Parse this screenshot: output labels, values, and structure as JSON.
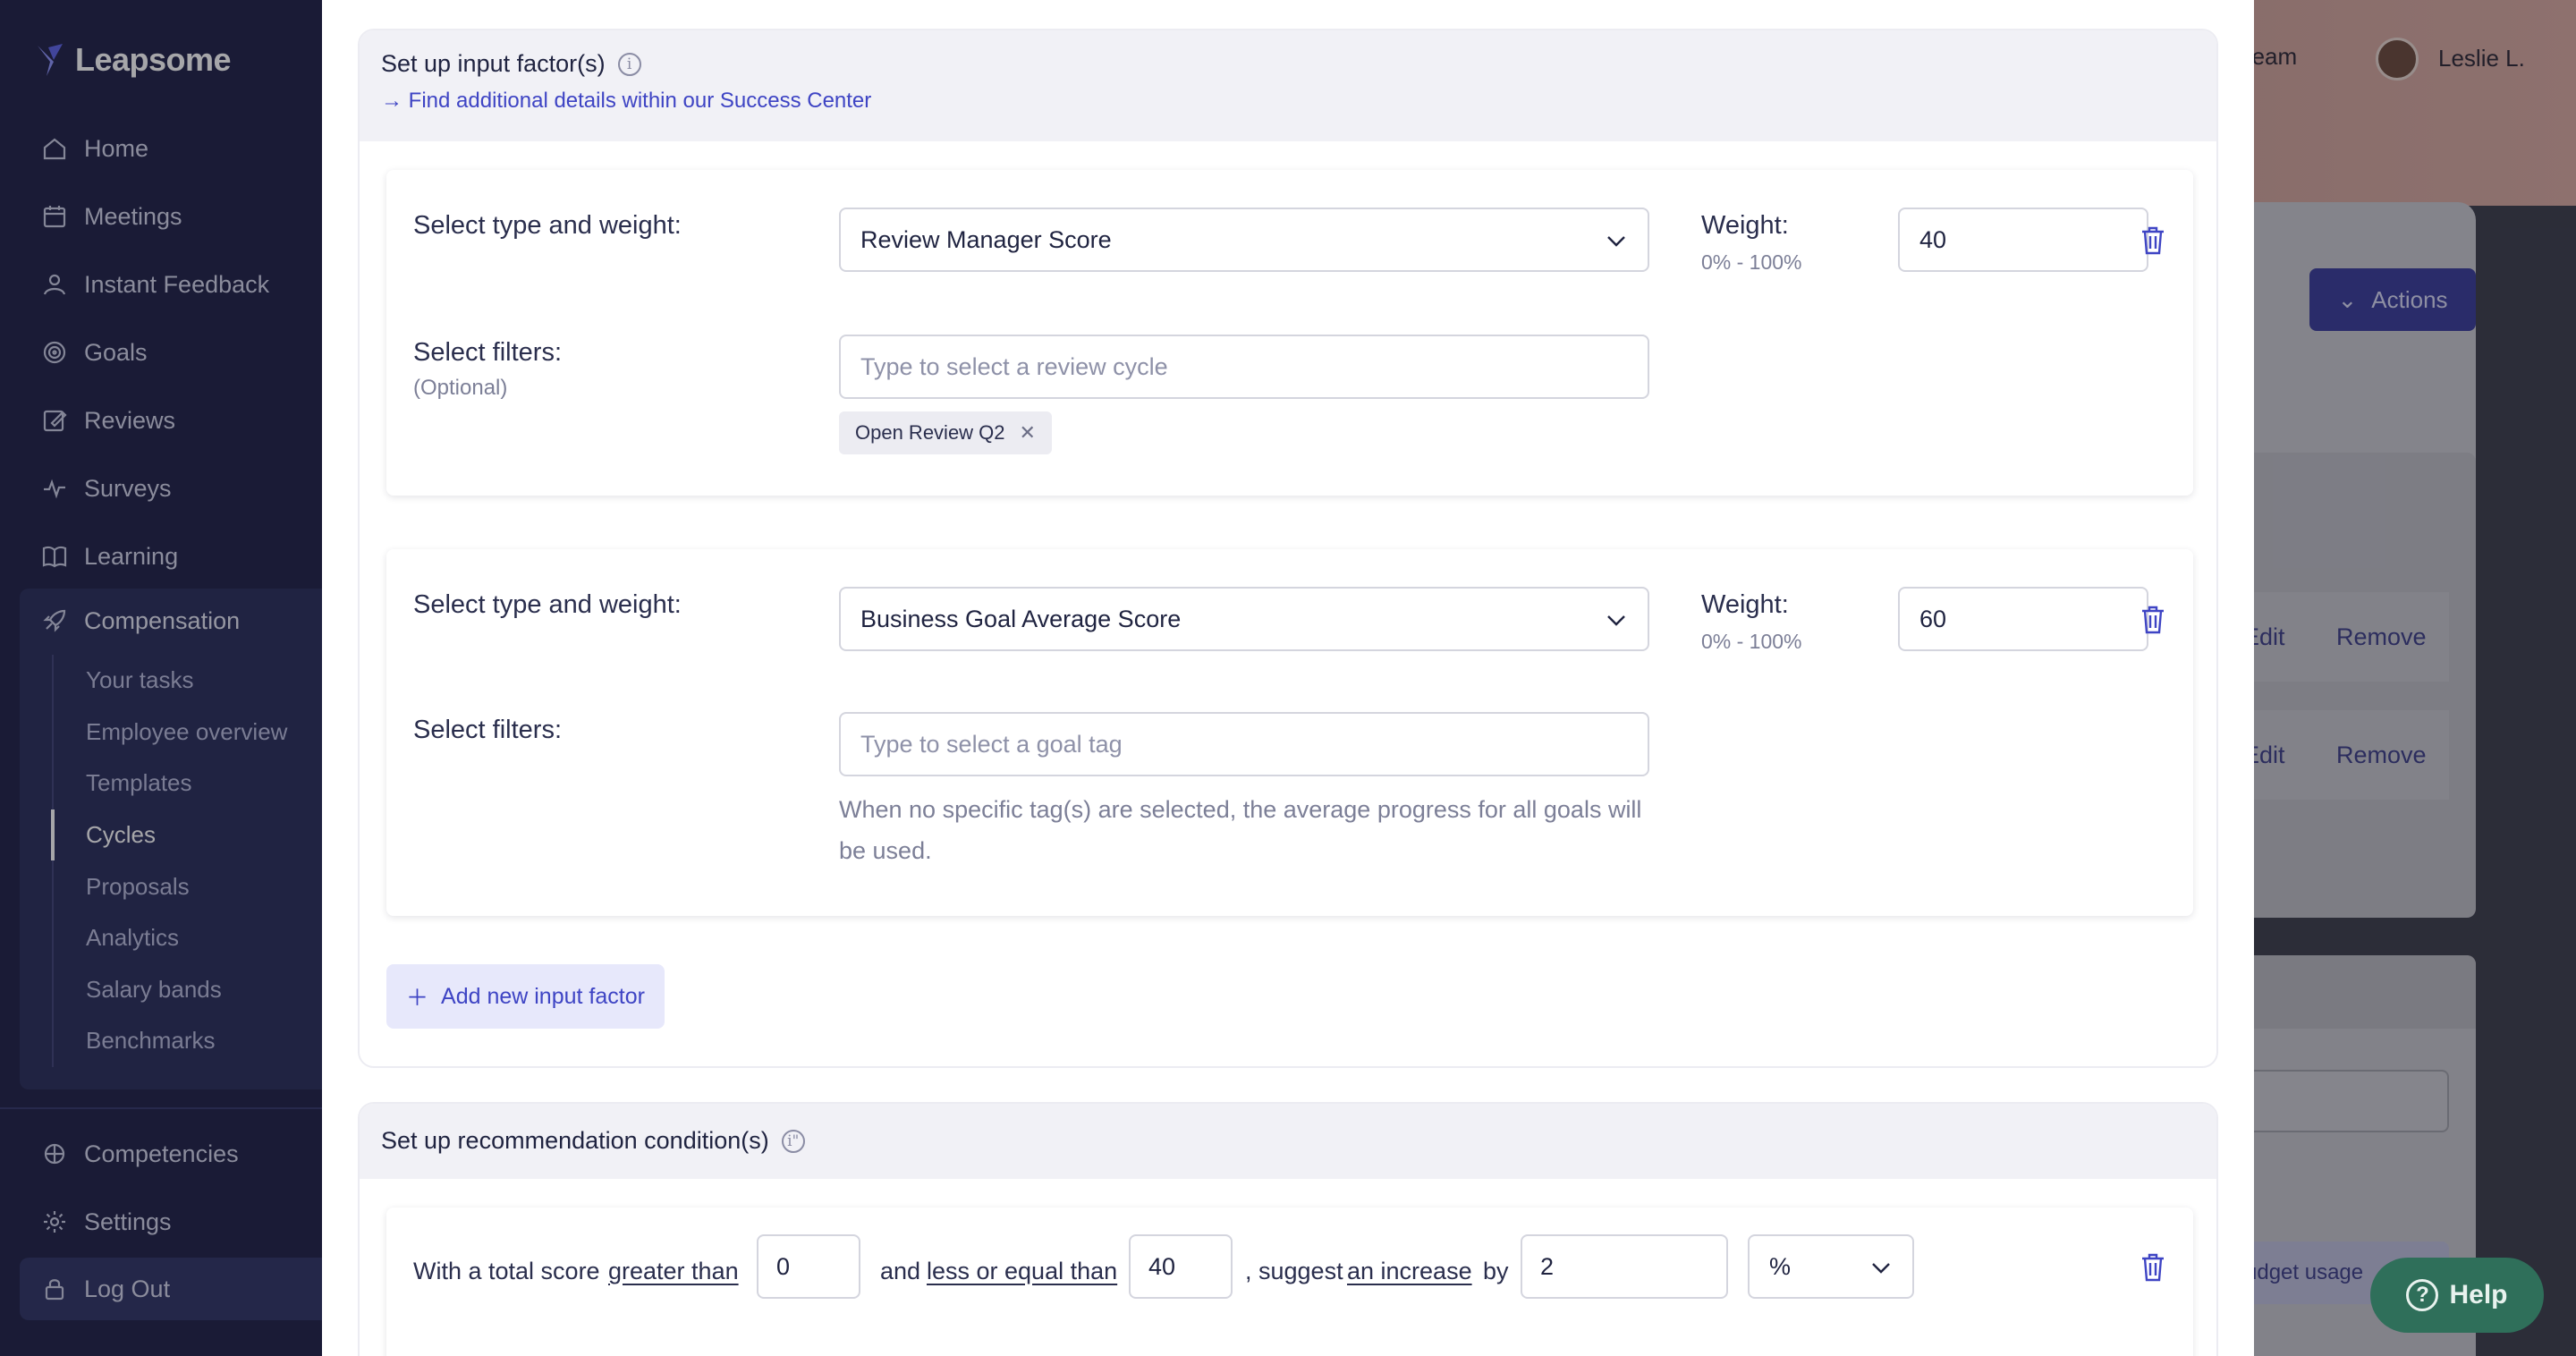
{
  "app": {
    "name": "Leapsome"
  },
  "sidebar": {
    "items": [
      {
        "label": "Home",
        "icon": "home-icon"
      },
      {
        "label": "Meetings",
        "icon": "calendar-icon"
      },
      {
        "label": "Instant Feedback",
        "icon": "feedback-icon"
      },
      {
        "label": "Goals",
        "icon": "target-icon"
      },
      {
        "label": "Reviews",
        "icon": "edit-icon"
      },
      {
        "label": "Surveys",
        "icon": "pulse-icon"
      },
      {
        "label": "Learning",
        "icon": "book-icon"
      }
    ],
    "compensation": {
      "label": "Compensation",
      "sub_items": [
        "Your tasks",
        "Employee overview",
        "Templates",
        "Cycles",
        "Proposals",
        "Analytics",
        "Salary bands",
        "Benchmarks"
      ],
      "active": "Cycles"
    },
    "bottom_items": [
      {
        "label": "Competencies",
        "icon": "competencies-icon"
      },
      {
        "label": "Settings",
        "icon": "gear-icon"
      }
    ],
    "logout": "Log Out"
  },
  "background": {
    "team_link": "ur team",
    "user_name": "Leslie L.",
    "actions_label": "Actions",
    "rows": [
      {
        "edit": "Edit",
        "remove": "Remove"
      },
      {
        "edit": "Edit",
        "remove": "Remove"
      }
    ],
    "budget_usage": "udget usage",
    "help_label": "Help"
  },
  "input_factors": {
    "title": "Set up input factor(s)",
    "link": "→ Find additional details within our Success Center",
    "factors": [
      {
        "type_label": "Select type and weight:",
        "type_value": "Review Manager Score",
        "weight_label": "Weight:",
        "weight_range": "0% - 100%",
        "weight_value": "40",
        "filters_label": "Select filters:",
        "filters_optional": "(Optional)",
        "filter_placeholder": "Type to select a review cycle",
        "tags": [
          "Open Review Q2"
        ]
      },
      {
        "type_label": "Select type and weight:",
        "type_value": "Business Goal Average Score",
        "weight_label": "Weight:",
        "weight_range": "0% - 100%",
        "weight_value": "60",
        "filters_label": "Select filters:",
        "filter_placeholder": "Type to select a goal tag",
        "hint": "When no specific tag(s) are selected, the average progress for all goals will be used."
      }
    ],
    "add_label": "Add new input factor"
  },
  "conditions": {
    "title": "Set up recommendation condition(s)",
    "row": {
      "t1": "With a total score",
      "cmp1": "greater than",
      "v1": "0",
      "t2": "and",
      "cmp2": "less or equal than",
      "v2": "40",
      "t3": ", suggest",
      "action": "an increase",
      "t4": "by",
      "amount": "2",
      "unit": "%"
    }
  }
}
